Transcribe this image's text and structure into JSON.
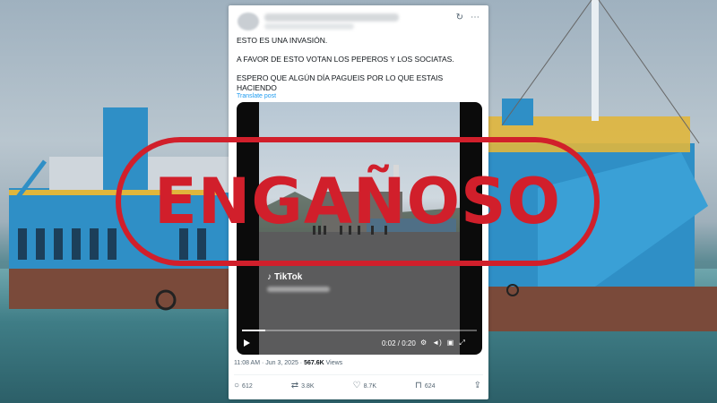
{
  "tweet": {
    "line1": "ESTO ES UNA INVASIÓN.",
    "line2": "A FAVOR DE ESTO VOTAN LOS PEPEROS Y LOS SOCIATAS.",
    "line3": "ESPERO QUE ALGÚN DÍA PAGUEIS POR LO QUE ESTAIS HACIENDO",
    "translate": "Translate post",
    "timestamp": "11:08 AM · Jun 3, 2025 · ",
    "views_count": "567.6K",
    "views_label": " Views"
  },
  "video": {
    "watermark": "TikTok",
    "time": "0:02 / 0:20",
    "progress": 0.1
  },
  "actions": {
    "replies": "612",
    "reposts": "3.8K",
    "likes": "8.7K",
    "bookmarks": "624"
  },
  "stamp": {
    "label": "ENGAÑOSO",
    "color": "#d11f2b"
  },
  "icons": [
    "grok-icon",
    "more-icon",
    "play-icon",
    "settings-icon",
    "volume-icon",
    "fullscreen-icon",
    "reply-icon",
    "repost-icon",
    "like-icon",
    "bookmark-icon",
    "share-icon",
    "tiktok-logo-icon"
  ]
}
